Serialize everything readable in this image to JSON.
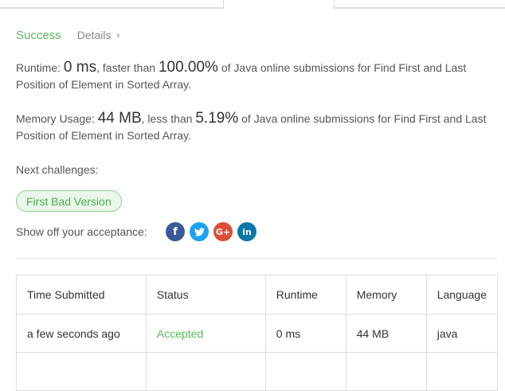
{
  "result": {
    "status": "Success",
    "details_label": "Details",
    "runtime_label": "Runtime:",
    "runtime_value": "0 ms",
    "faster_than": ", faster than",
    "runtime_percent": "100.00%",
    "runtime_desc": "of Java online submissions for Find First and Last Position of Element in Sorted Array.",
    "memory_label": "Memory Usage:",
    "memory_value": "44 MB",
    "less_than": ", less than",
    "memory_percent": "5.19%",
    "memory_desc": "of Java online submissions for Find First and Last Position of Element in Sorted Array."
  },
  "next": {
    "label": "Next challenges:",
    "challenge": "First Bad Version"
  },
  "share": {
    "label": "Show off your acceptance:",
    "icons": [
      "facebook-icon",
      "twitter-icon",
      "google-plus-icon",
      "linkedin-icon"
    ]
  },
  "table": {
    "headers": [
      "Time Submitted",
      "Status",
      "Runtime",
      "Memory",
      "Language"
    ],
    "rows": [
      [
        "a few seconds ago",
        "Accepted",
        "0 ms",
        "44 MB",
        "java"
      ]
    ]
  },
  "colors": {
    "success": "#5cb85c",
    "facebook": "#3b5998",
    "twitter": "#1da1f2",
    "google_plus": "#dd4b39",
    "linkedin": "#0e76a8"
  }
}
